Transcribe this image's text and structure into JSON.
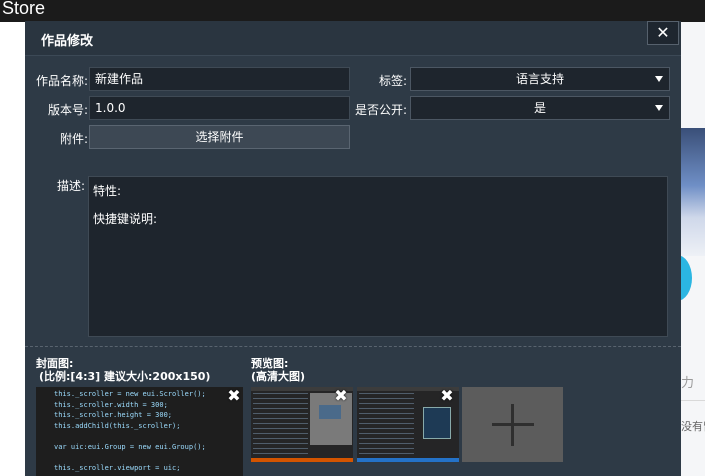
{
  "topbar": {
    "title": "Store"
  },
  "background": {
    "side_char": "力",
    "side_text": "没有留"
  },
  "dialog": {
    "title": "作品修改",
    "close_glyph": "✕",
    "name_label": "作品名称:",
    "name_value": "新建作品",
    "tags_label": "标签:",
    "tags_value": "语言支持",
    "version_label": "版本号:",
    "version_value": "1.0.0",
    "public_label": "是否公开:",
    "public_value": "是",
    "attach_label": "附件:",
    "attach_button": "选择附件",
    "desc_label": "描述:",
    "desc_line1": "特性:",
    "desc_line2": "快捷键说明:",
    "cover_label_line1": "封面图:",
    "cover_label_line2": "(比例:[4:3] 建议大小:200x150)",
    "preview_label_line1": "预览图:",
    "preview_label_line2": "(高清大图)",
    "remove_glyph": "✖",
    "add_glyph": "+",
    "cover_code": [
      "this._scroller = new eui.Scroller();",
      "this._scroller.width = 300;",
      "this._scroller.height = 300;",
      "this.addChild(this._scroller);",
      "",
      "var uic:eui.Group = new eui.Group();",
      "",
      "this._scroller.viewport = uic;"
    ]
  }
}
